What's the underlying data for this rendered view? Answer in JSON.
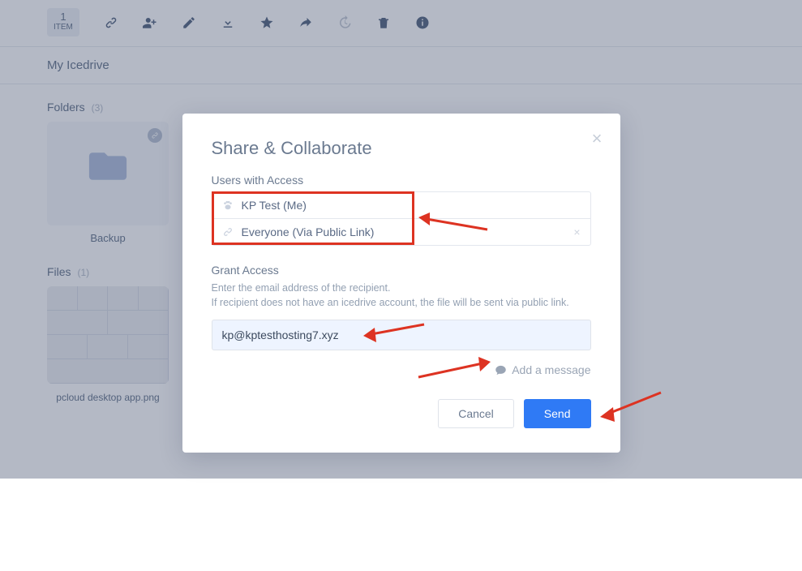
{
  "toolbar": {
    "selection_count": "1",
    "selection_label": "ITEM"
  },
  "breadcrumb": "My Icedrive",
  "sections": {
    "folders_label": "Folders",
    "folders_count": "(3)",
    "files_label": "Files",
    "files_count": "(1)"
  },
  "folders": [
    {
      "name": "Backup"
    }
  ],
  "files": [
    {
      "name": "pcloud desktop app.png"
    }
  ],
  "modal": {
    "title": "Share & Collaborate",
    "users_heading": "Users with Access",
    "users": [
      {
        "label": "KP Test (Me)"
      },
      {
        "label": "Everyone (Via Public Link)"
      }
    ],
    "grant_heading": "Grant Access",
    "helper_line1": "Enter the email address of the recipient.",
    "helper_line2": "If recipient does not have an icedrive account, the file will be sent via public link.",
    "email_value": "kp@kptesthosting7.xyz",
    "add_message_label": "Add a message",
    "cancel_label": "Cancel",
    "send_label": "Send"
  }
}
